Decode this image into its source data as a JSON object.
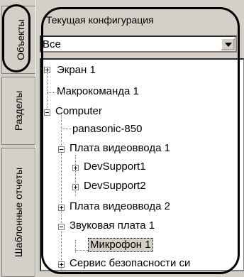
{
  "tabs": {
    "objects": "Объекты",
    "sections": "Разделы",
    "templates": "Шаблонные отчеты"
  },
  "panel": {
    "group_title": "Текущая конфигурация",
    "combo_value": "Все"
  },
  "tree": {
    "items": [
      {
        "label": "Экран 1"
      },
      {
        "label": "Макрокоманда 1"
      },
      {
        "label": "Computer"
      },
      {
        "label": "panasonic-850"
      },
      {
        "label": "Плата видеоввода 1"
      },
      {
        "label": "DevSupport1"
      },
      {
        "label": "DevSupport2"
      },
      {
        "label": "Плата видеоввода 2"
      },
      {
        "label": "Звуковая плата 1"
      },
      {
        "label": "Микрофон 1"
      },
      {
        "label": "Сервис безопасности си"
      }
    ]
  }
}
